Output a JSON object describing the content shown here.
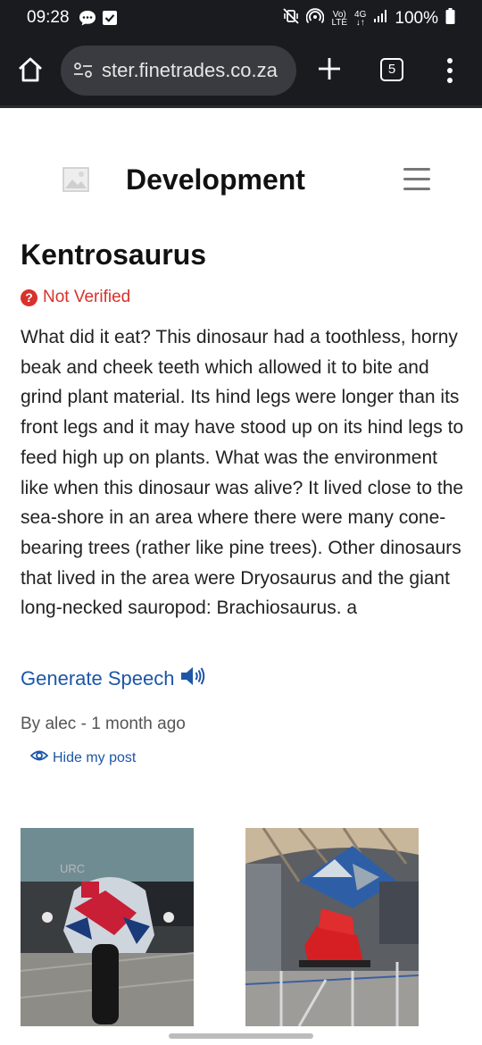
{
  "status": {
    "time": "09:28",
    "volte_top": "Vo)",
    "volte_bottom": "LTE",
    "network_top": "4G",
    "network_bottom": "↓↑",
    "battery": "100%",
    "icons": [
      "chat-bubble-icon",
      "checkbox-icon",
      "mute-vibrate-icon",
      "hotspot-icon",
      "signal-icon",
      "battery-icon"
    ]
  },
  "browser": {
    "url": "ster.finetrades.co.za",
    "tab_count": "5",
    "icons": [
      "home-icon",
      "site-settings-icon",
      "plus-icon",
      "tabs-icon",
      "more-vert-icon"
    ]
  },
  "site": {
    "title": "Development",
    "icons": [
      "broken-image-icon",
      "hamburger-menu-icon"
    ]
  },
  "post": {
    "title": "Kentrosaurus",
    "status": "Not Verified",
    "body": "What did it eat? This dinosaur had a toothless, horny beak and cheek teeth which allowed it to bite and grind plant material. Its hind legs were longer than its front legs and it may have stood up on its hind legs to feed high up on plants. What was the environment like when this dinosaur was alive? It lived close to the sea-shore in an area where there were many cone-bearing trees (rather like pine trees). Other dinosaurs that lived in the area were Dryosaurus and the giant long-necked sauropod: Brachiosaurus. a",
    "speech_label": "Generate Speech",
    "byline": "By alec - 1 month ago",
    "hide_label": "Hide my post"
  },
  "photos": {
    "photo1_sign": "URC"
  },
  "colors": {
    "bar_bg": "#1a1b1f",
    "url_pill": "#3a3b40",
    "link_blue": "#1d56a8",
    "error_red": "#d9312b"
  }
}
